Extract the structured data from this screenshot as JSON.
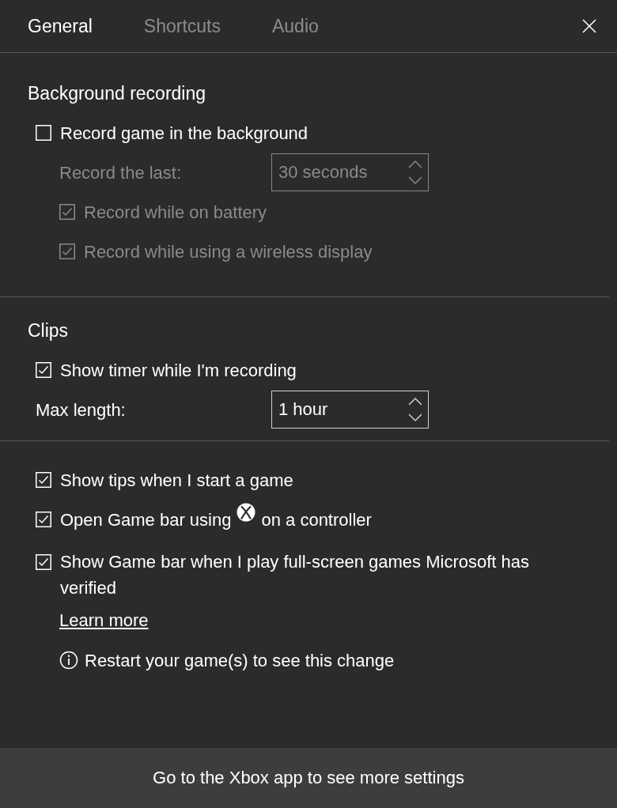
{
  "tabs": [
    {
      "label": "General",
      "selected": true
    },
    {
      "label": "Shortcuts",
      "selected": false
    },
    {
      "label": "Audio",
      "selected": false
    }
  ],
  "sections": [
    {
      "heading": "Background recording",
      "items": [
        {
          "kind": "checkbox",
          "label": "Record game in the background",
          "checked": false,
          "disabled": false,
          "children": [
            {
              "kind": "select",
              "label": "Record the last:",
              "value": "30 seconds",
              "disabled": true
            },
            {
              "kind": "checkbox",
              "label": "Record while on battery",
              "checked": true,
              "disabled": true
            },
            {
              "kind": "checkbox",
              "label": "Record while using a wireless display",
              "checked": true,
              "disabled": true
            }
          ]
        }
      ]
    },
    {
      "heading": "Clips",
      "items": [
        {
          "kind": "checkbox",
          "label": "Show timer while I'm recording",
          "checked": true,
          "disabled": false
        },
        {
          "kind": "select",
          "label": "Max length:",
          "value": "1 hour",
          "disabled": false
        }
      ]
    },
    {
      "items": [
        {
          "kind": "checkbox",
          "label": "Show tips when I start a game",
          "checked": true,
          "disabled": false
        },
        {
          "kind": "checkbox",
          "label": "Open Game bar using",
          "label_after": "on a controller",
          "checked": true,
          "disabled": false
        },
        {
          "kind": "checkbox",
          "label": "Show Game bar when I play full-screen games Microsoft has verified",
          "checked": true,
          "disabled": false,
          "children": [
            {
              "kind": "link",
              "label": "Learn more"
            },
            {
              "kind": "note",
              "label": "Restart your game(s) to see this change"
            }
          ]
        }
      ]
    }
  ],
  "footer": {
    "label": "Go to the Xbox app to see more settings"
  }
}
